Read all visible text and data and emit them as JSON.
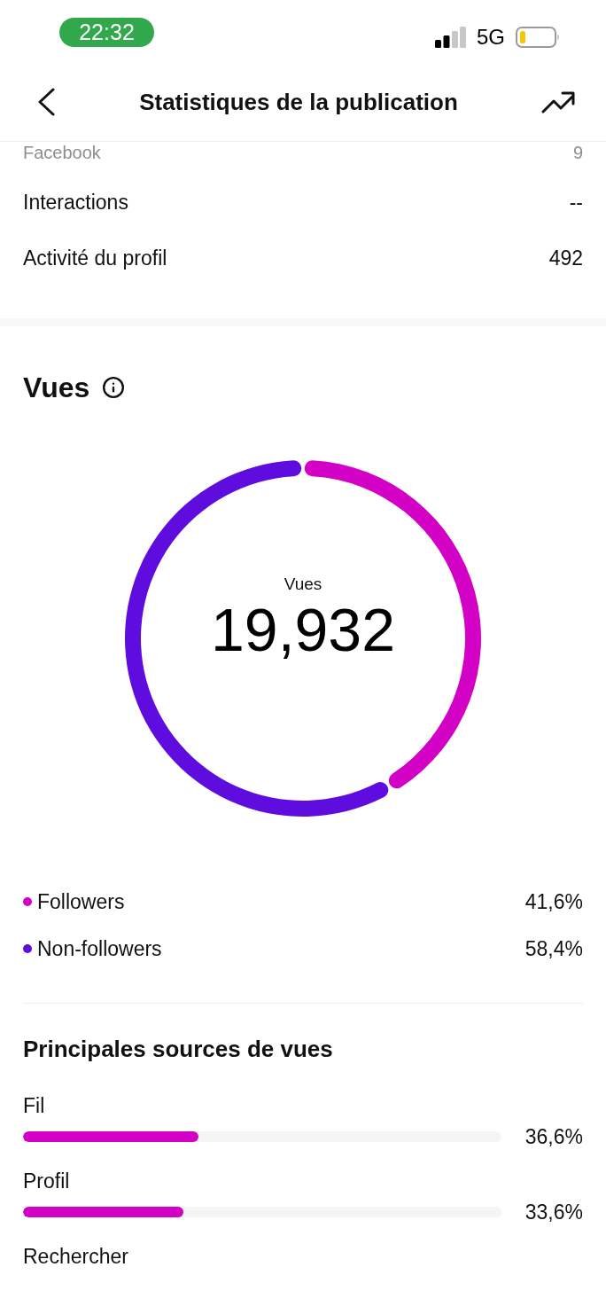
{
  "status_bar": {
    "time": "22:32",
    "network": "5G"
  },
  "header": {
    "title": "Statistiques de la publication"
  },
  "stats": [
    {
      "label": "Facebook",
      "value": "9",
      "dimmed": true
    },
    {
      "label": "Interactions",
      "value": "--",
      "dimmed": false
    },
    {
      "label": "Activité du profil",
      "value": "492",
      "dimmed": false
    }
  ],
  "views": {
    "title": "Vues",
    "chart_data": {
      "type": "donut",
      "categories": [
        "Followers",
        "Non-followers"
      ],
      "values": [
        41.6,
        58.4
      ]
    },
    "center_label": "Vues",
    "center_value": "19,932",
    "legend": [
      {
        "value": "41,6%",
        "color": "#d300c5"
      },
      {
        "value": "58,4%",
        "color": "#5f0ddf"
      }
    ]
  },
  "sources": {
    "title": "Principales sources de vues",
    "items": [
      {
        "label": "Fil",
        "level": 0.366,
        "reading": "36,6%"
      },
      {
        "label": "Profil",
        "level": 0.336,
        "reading": "33,6%"
      },
      {
        "label": "Rechercher"
      }
    ]
  }
}
